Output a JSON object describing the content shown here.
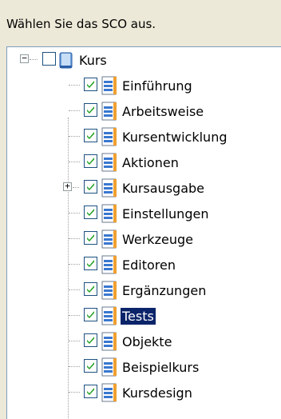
{
  "prompt": "Wählen Sie das SCO aus.",
  "tree": {
    "root": {
      "label": "Kurs",
      "expander": "−",
      "checked": false,
      "icon": "book-icon"
    },
    "children": [
      {
        "label": "Einführung",
        "checked": true,
        "icon": "page-icon"
      },
      {
        "label": "Arbeitsweise",
        "checked": true,
        "icon": "page-icon"
      },
      {
        "label": "Kursentwicklung",
        "checked": true,
        "icon": "page-icon"
      },
      {
        "label": "Aktionen",
        "checked": true,
        "icon": "page-icon"
      },
      {
        "label": "Kursausgabe",
        "checked": true,
        "icon": "page-icon",
        "expander": "+"
      },
      {
        "label": "Einstellungen",
        "checked": true,
        "icon": "page-icon"
      },
      {
        "label": "Werkzeuge",
        "checked": true,
        "icon": "page-icon"
      },
      {
        "label": "Editoren",
        "checked": true,
        "icon": "page-icon"
      },
      {
        "label": "Ergänzungen",
        "checked": true,
        "icon": "page-icon"
      },
      {
        "label": "Tests",
        "checked": true,
        "icon": "page-icon",
        "selected": true
      },
      {
        "label": "Objekte",
        "checked": true,
        "icon": "page-icon"
      },
      {
        "label": "Beispielkurs",
        "checked": true,
        "icon": "page-icon"
      },
      {
        "label": "Kursdesign",
        "checked": true,
        "icon": "page-icon"
      }
    ]
  },
  "colors": {
    "selection_bg": "#0a246a",
    "selection_fg": "#ffffff",
    "window_bg": "#ece9d8",
    "tree_bg": "#ffffff"
  }
}
